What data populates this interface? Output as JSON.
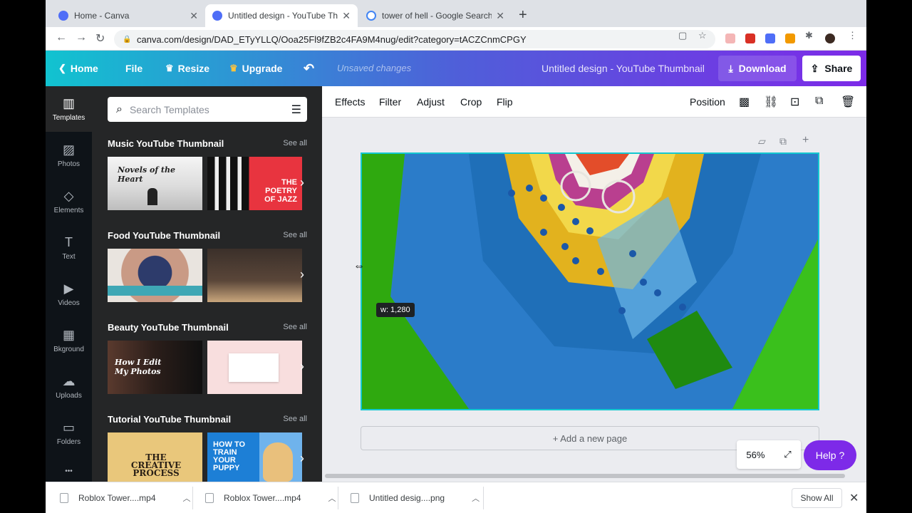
{
  "browser": {
    "tabs": [
      {
        "title": "Home - Canva",
        "icon": "canva-favicon"
      },
      {
        "title": "Untitled design - YouTube Thum",
        "icon": "canva-favicon"
      },
      {
        "title": "tower of hell - Google Search",
        "icon": "google-favicon"
      }
    ],
    "new_tab_label": "+",
    "url": "canva.com/design/DAD_ETyYLLQ/Ooa25Fl9fZB2c4FA9M4nug/edit?category=tACZCnmCPGY"
  },
  "header": {
    "home_label": "Home",
    "file_label": "File",
    "resize_label": "Resize",
    "upgrade_label": "Upgrade",
    "status": "Unsaved changes",
    "doc_title": "Untitled design - YouTube Thumbnail",
    "download_label": "Download",
    "share_label": "Share",
    "accent": "#7d2ae8",
    "gradient_start": "#11c3d0"
  },
  "rail": {
    "items": [
      {
        "label": "Templates",
        "icon": "templates-icon"
      },
      {
        "label": "Photos",
        "icon": "photos-icon"
      },
      {
        "label": "Elements",
        "icon": "elements-icon"
      },
      {
        "label": "Text",
        "icon": "text-icon"
      },
      {
        "label": "Videos",
        "icon": "videos-icon"
      },
      {
        "label": "Bkground",
        "icon": "background-icon"
      },
      {
        "label": "Uploads",
        "icon": "uploads-icon"
      },
      {
        "label": "Folders",
        "icon": "folders-icon"
      },
      {
        "label": "•••",
        "icon": "more-icon"
      }
    ]
  },
  "panel": {
    "search_placeholder": "Search Templates",
    "sections": [
      {
        "title": "Music YouTube Thumbnail",
        "see_all": "See all",
        "thumb_texts": [
          "Novels of the Heart",
          "THE POETRY OF JAZZ"
        ]
      },
      {
        "title": "Food YouTube Thumbnail",
        "see_all": "See all",
        "thumb_texts": [
          "",
          ""
        ]
      },
      {
        "title": "Beauty YouTube Thumbnail",
        "see_all": "See all",
        "thumb_texts": [
          "How I Edit My Photos",
          ""
        ]
      },
      {
        "title": "Tutorial YouTube Thumbnail",
        "see_all": "See all",
        "thumb_texts": [
          "THE CREATIVE PROCESS",
          "HOW TO TRAIN YOUR PUPPY"
        ]
      }
    ]
  },
  "toolbar": {
    "effects": "Effects",
    "filter": "Filter",
    "adjust": "Adjust",
    "crop": "Crop",
    "flip": "Flip",
    "position": "Position"
  },
  "canvas": {
    "width_readout": "w: 1,280",
    "add_page": "+ Add a new page",
    "zoom": "56%",
    "help": "Help ?"
  },
  "downloads": {
    "items": [
      "Roblox Tower....mp4",
      "Roblox Tower....mp4",
      "Untitled desig....png"
    ],
    "show_all": "Show All"
  }
}
